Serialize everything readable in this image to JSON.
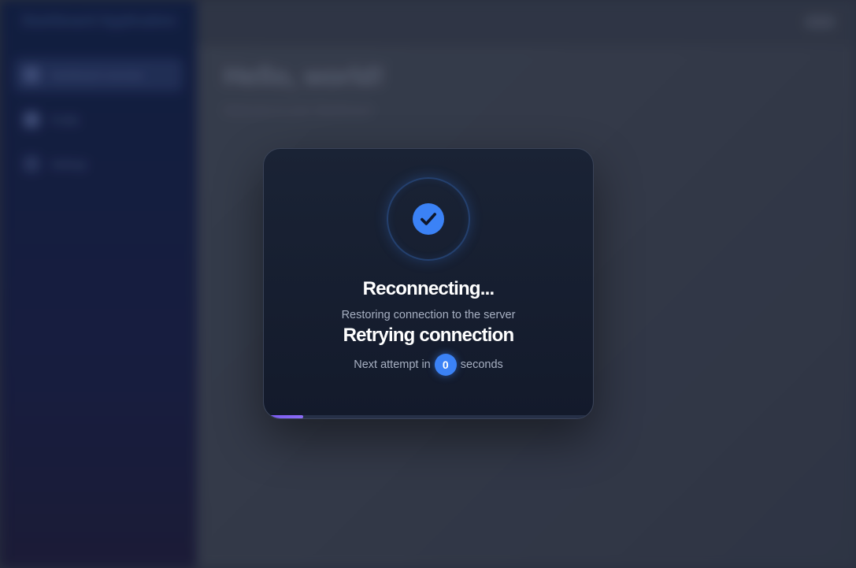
{
  "background": {
    "sidebar": {
      "brand": "Dashboard Application",
      "items": [
        {
          "label": "Dashboard overview"
        },
        {
          "label": "Profile"
        },
        {
          "label": "Settings"
        }
      ]
    },
    "main": {
      "heading": "Hello, world!",
      "subheading": "Welcome to your dashboard"
    }
  },
  "modal": {
    "title": "Reconnecting...",
    "subtitle": "Restoring connection to the server",
    "status": "Retrying connection",
    "countdown_prefix": "Next attempt in",
    "countdown_value": "0",
    "countdown_suffix": "seconds",
    "progress_percent": 12
  },
  "colors": {
    "accent": "#3b82f6",
    "progress": "#8b6cf6",
    "modal_bg": "#161e2f"
  },
  "icons": {
    "status": "check-circle-icon"
  }
}
